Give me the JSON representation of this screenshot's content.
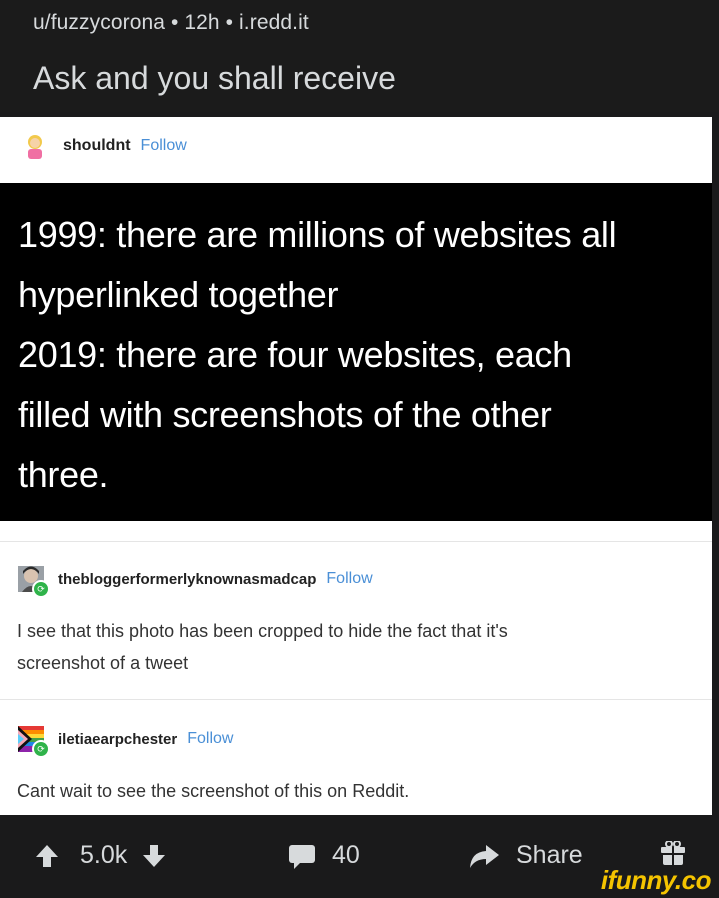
{
  "post": {
    "author": "u/fuzzycorona",
    "separator": " • ",
    "age": "12h",
    "domain": "i.redd.it",
    "title": "Ask and you shall receive"
  },
  "posts": [
    {
      "blog": "shouldnt",
      "follow": "Follow",
      "tweet_lines": [
        "1999: there are millions of websites all",
        "hyperlinked together",
        "2019: there are four websites, each",
        "filled with screenshots of the other",
        "three."
      ]
    },
    {
      "blog": "thebloggerformerlyknownasmadcap",
      "follow": "Follow",
      "comment_lines": [
        "I see that this photo has been cropped to hide the fact that it's",
        "screenshot of a tweet"
      ]
    },
    {
      "blog": "iletiaearpchester",
      "follow": "Follow",
      "comment_lines": [
        "Cant wait to see the screenshot of this on Reddit."
      ]
    }
  ],
  "actions": {
    "votes": "5.0k",
    "comments": "40",
    "share": "Share"
  },
  "watermark": "ifunny.co",
  "colors": {
    "accent_follow": "#4a8fd6",
    "background": "#1a1a1b",
    "watermark": "#f5c400",
    "reblog": "#2fb34a"
  }
}
